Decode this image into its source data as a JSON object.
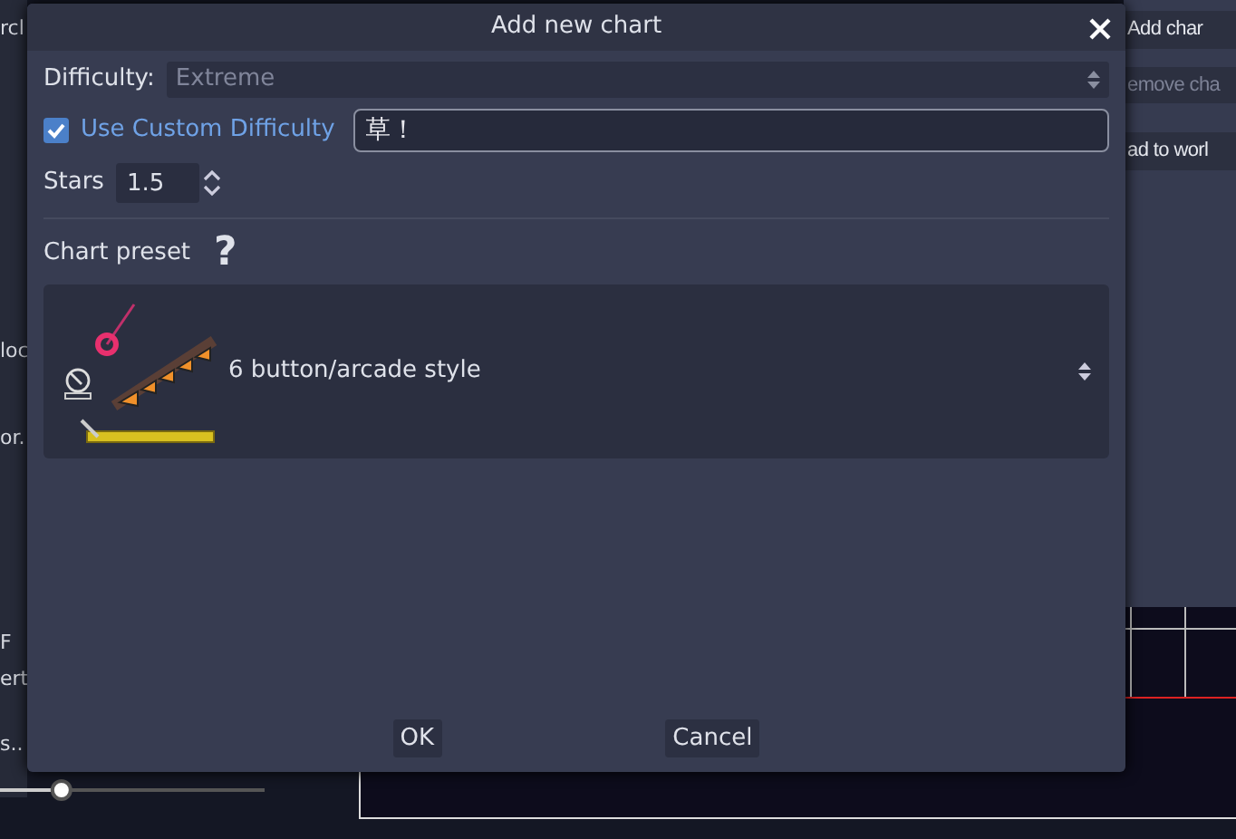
{
  "background": {
    "left_labels": [
      "rcl",
      "loc",
      "or.",
      "F",
      "ert",
      "s.."
    ],
    "right_buttons": [
      "Add char",
      "emove cha",
      "ad to worl"
    ],
    "slider": {
      "level": 0.22
    }
  },
  "dialog": {
    "title": "Add new chart",
    "difficulty": {
      "label": "Difficulty:",
      "value": "Extreme",
      "disabled": true
    },
    "custom": {
      "label": "Use Custom Difficulty",
      "checked": true,
      "value": "草！"
    },
    "stars": {
      "label": "Stars",
      "value": "1.5"
    },
    "preset": {
      "label": "Chart preset",
      "help": "?",
      "value": "6 button/arcade style"
    },
    "buttons": [
      "OK",
      "Cancel"
    ]
  }
}
